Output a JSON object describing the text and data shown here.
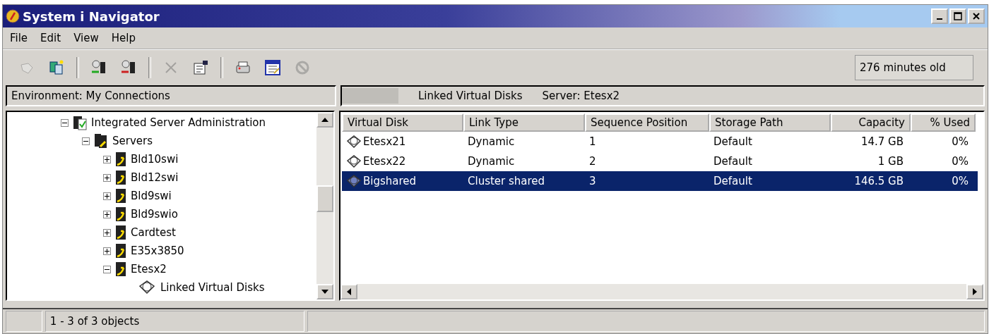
{
  "window": {
    "title": "System i Navigator"
  },
  "menu": [
    "File",
    "Edit",
    "View",
    "Help"
  ],
  "toolbar": [
    {
      "kind": "hand",
      "disabled": true
    },
    {
      "kind": "copy",
      "disabled": false
    },
    {
      "kind": "connect",
      "disabled": false
    },
    {
      "kind": "disconnect",
      "disabled": false
    },
    {
      "kind": "delete",
      "disabled": true
    },
    {
      "kind": "properties",
      "disabled": false
    },
    {
      "kind": "printer",
      "disabled": false
    },
    {
      "kind": "calendar",
      "disabled": false
    },
    {
      "kind": "stop",
      "disabled": true
    }
  ],
  "refresh_status": "276 minutes old",
  "left_header": "Environment: My Connections",
  "tree": [
    {
      "label": "Integrated Server Administration",
      "kind": "admin",
      "expanded": true,
      "children": [
        {
          "label": "Servers",
          "kind": "servers",
          "expanded": true,
          "children": [
            {
              "label": "Bld10swi",
              "kind": "server",
              "expanded": false
            },
            {
              "label": "Bld12swi",
              "kind": "server",
              "expanded": false
            },
            {
              "label": "Bld9swi",
              "kind": "server",
              "expanded": false
            },
            {
              "label": "Bld9swio",
              "kind": "server",
              "expanded": false
            },
            {
              "label": "Cardtest",
              "kind": "server",
              "expanded": false
            },
            {
              "label": "E35x3850",
              "kind": "server",
              "expanded": false
            },
            {
              "label": "Etesx2",
              "kind": "server",
              "expanded": true,
              "children": [
                {
                  "label": "Linked Virtual Disks",
                  "kind": "disks"
                }
              ]
            }
          ]
        }
      ]
    }
  ],
  "right_header": {
    "title": "Linked Virtual Disks",
    "server": "Server: Etesx2"
  },
  "table": {
    "columns": [
      {
        "label": "Virtual Disk",
        "kind": "text"
      },
      {
        "label": "Link Type",
        "kind": "text"
      },
      {
        "label": "Sequence Position",
        "kind": "text"
      },
      {
        "label": "Storage Path",
        "kind": "text"
      },
      {
        "label": "Capacity",
        "kind": "number"
      },
      {
        "label": "% Used",
        "kind": "number"
      }
    ],
    "rows": [
      {
        "selected": false,
        "cells": [
          "Etesx21",
          "Dynamic",
          "1",
          "Default",
          "14.7 GB",
          "0%"
        ]
      },
      {
        "selected": false,
        "cells": [
          "Etesx22",
          "Dynamic",
          "2",
          "Default",
          "1 GB",
          "0%"
        ]
      },
      {
        "selected": true,
        "cells": [
          "Bigshared",
          "Cluster shared",
          "3",
          "Default",
          "146.5 GB",
          "0%"
        ]
      }
    ]
  },
  "status_bar": "1 - 3 of 3 objects"
}
